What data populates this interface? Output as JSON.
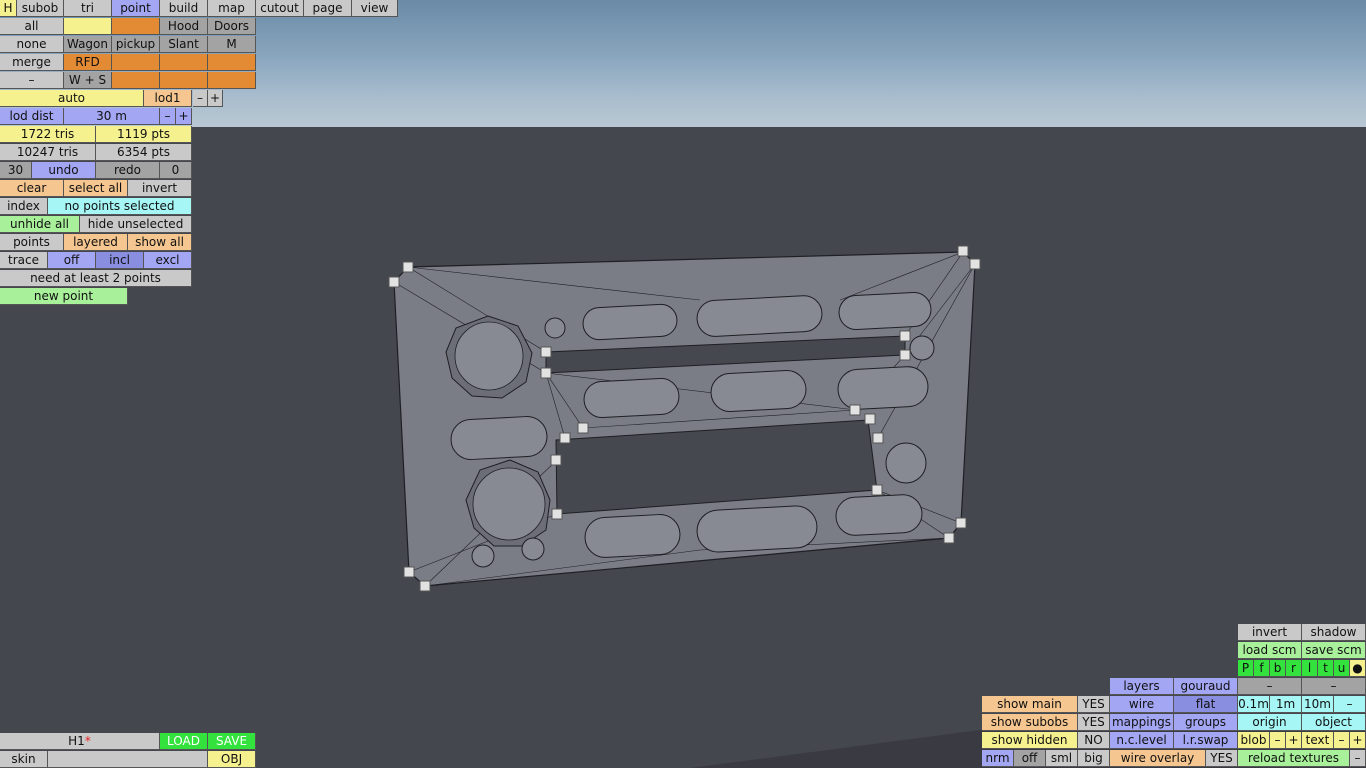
{
  "colors": {
    "sky_top": "#6a8aa6",
    "ground": "#45474e",
    "panel": "#7b7d86",
    "mesh_line": "#1e1f24",
    "handle": "#e2e2e2"
  },
  "top_bar": {
    "h": "H",
    "subob": "subob",
    "tri": "tri",
    "point": "point",
    "build": "build",
    "map": "map",
    "cutout": "cutout",
    "page": "page",
    "view": "view"
  },
  "parts": {
    "all": "all",
    "none": "none",
    "merge": "merge",
    "minus": "–",
    "wagon": "Wagon",
    "pickup": "pickup",
    "hood": "Hood",
    "doors": "Doors",
    "slant": "Slant",
    "m": "M",
    "rfd": "RFD",
    "ws": "W + S"
  },
  "lod": {
    "auto": "auto",
    "lod1": "lod1",
    "minus": "–",
    "plus": "+",
    "lod_dist": "lod dist",
    "dist_value": "30 m"
  },
  "stats": {
    "tris": "1722 tris",
    "pts": "1119 pts",
    "total_tris": "10247 tris",
    "total_pts": "6354 pts"
  },
  "history": {
    "count": "30",
    "undo": "undo",
    "redo": "redo",
    "redo_count": "0"
  },
  "selection": {
    "clear": "clear",
    "select_all": "select all",
    "invert": "invert",
    "index": "index",
    "status": "no points selected",
    "unhide_all": "unhide all",
    "hide_unselected": "hide unselected",
    "points": "points",
    "layered": "layered",
    "show_all": "show all"
  },
  "trace": {
    "label": "trace",
    "off": "off",
    "incl": "incl",
    "excl": "excl",
    "message": "need at least 2 points",
    "new_point": "new point"
  },
  "file": {
    "name": "H1",
    "modified": "*",
    "load": "LOAD",
    "save": "SAVE",
    "skin": "skin",
    "obj": "OBJ"
  },
  "view_panel": {
    "invert": "invert",
    "shadow": "shadow",
    "load_scm": "load scm",
    "save_scm": "save scm",
    "modes": [
      "P",
      "f",
      "b",
      "r",
      "l",
      "t",
      "u"
    ],
    "dot": "●",
    "dash": "–",
    "layers": "layers",
    "gouraud": "gouraud",
    "wire": "wire",
    "flat": "flat",
    "mappings": "mappings",
    "groups": "groups",
    "nclevel": "n.c.level",
    "lrswap": "l.r.swap",
    "wire_overlay": "wire overlay",
    "wire_overlay_val": "YES",
    "grid": [
      "0.1m",
      "1m",
      "10m"
    ],
    "origin": "origin",
    "object": "object",
    "blob": "blob",
    "text": "text",
    "reload_textures": "reload textures",
    "show_main": "show main",
    "show_main_val": "YES",
    "show_subobs": "show subobs",
    "show_subobs_val": "YES",
    "show_hidden": "show hidden",
    "show_hidden_val": "NO",
    "sizes": [
      "nrm",
      "off",
      "sml",
      "big"
    ]
  }
}
